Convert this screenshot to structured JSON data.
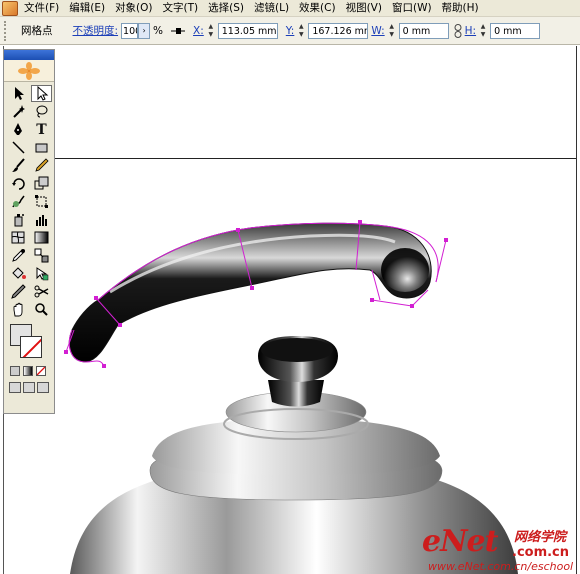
{
  "menubar": {
    "items": [
      "文件(F)",
      "编辑(E)",
      "对象(O)",
      "文字(T)",
      "选择(S)",
      "滤镜(L)",
      "效果(C)",
      "视图(V)",
      "窗口(W)",
      "帮助(H)"
    ]
  },
  "controlbar": {
    "selection_label": "网格点",
    "opacity_label": "不透明度:",
    "opacity_value": "100",
    "opacity_unit": "%",
    "x_label": "X:",
    "x_value": "113.05 mm",
    "y_label": "Y:",
    "y_value": "167.126 mm",
    "w_label": "W:",
    "w_value": "0 mm",
    "h_label": "H:",
    "h_value": "0 mm"
  },
  "tools": {
    "icons": [
      "selection-tool-icon",
      "direct-selection-tool-icon",
      "magic-wand-tool-icon",
      "lasso-tool-icon",
      "pen-tool-icon",
      "type-tool-icon",
      "line-segment-tool-icon",
      "rectangle-tool-icon",
      "paintbrush-tool-icon",
      "pencil-tool-icon",
      "rotate-tool-icon",
      "scale-tool-icon",
      "warp-tool-icon",
      "free-transform-tool-icon",
      "symbol-sprayer-tool-icon",
      "graph-tool-icon",
      "mesh-tool-icon",
      "gradient-tool-icon",
      "eyedropper-tool-icon",
      "blend-tool-icon",
      "live-paint-bucket-tool-icon",
      "live-paint-selection-tool-icon",
      "slice-tool-icon",
      "scissors-tool-icon",
      "hand-tool-icon",
      "zoom-tool-icon"
    ],
    "fill_color": "#e3e3e3",
    "stroke_color": "none"
  },
  "watermark": {
    "brand": "eNet",
    "cn": "网络学院",
    "com": ".com.cn",
    "url": "www.eNet.com.cn/eschool"
  },
  "colors": {
    "path_highlight": "#d21fd2",
    "watermark": "#cc1d1d",
    "handle_body": "#0a0a0a"
  }
}
